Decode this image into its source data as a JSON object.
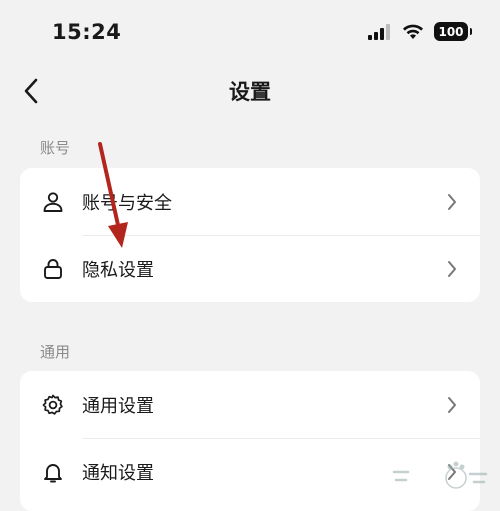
{
  "status_bar": {
    "time": "15:24",
    "battery": "100",
    "icons": [
      "signal-icon",
      "wifi-icon",
      "battery-icon"
    ]
  },
  "nav": {
    "title": "设置",
    "back_icon": "chevron-left-icon"
  },
  "sections": [
    {
      "label": "账号",
      "items": [
        {
          "label": "账号与安全",
          "icon": "user-icon"
        },
        {
          "label": "隐私设置",
          "icon": "lock-icon"
        }
      ]
    },
    {
      "label": "通用",
      "items": [
        {
          "label": "通用设置",
          "icon": "gear-icon"
        },
        {
          "label": "通知设置",
          "icon": "bell-icon"
        }
      ]
    }
  ],
  "annotation": {
    "arrow_color": "#b3261e"
  },
  "colors": {
    "background": "#f2f2f2",
    "card": "#ffffff",
    "secondary_text": "#8a8a8a"
  }
}
